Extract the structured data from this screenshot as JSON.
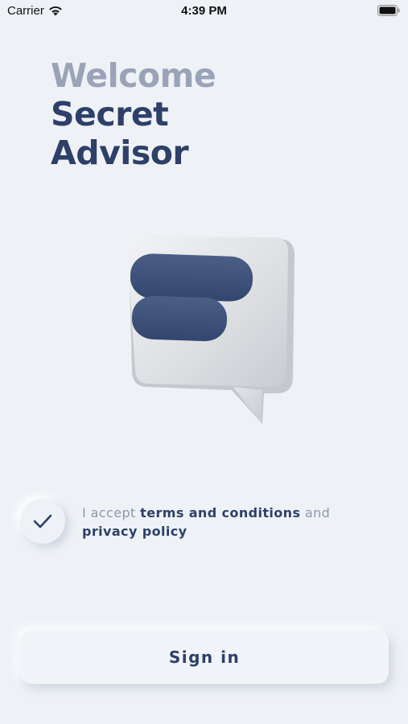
{
  "status_bar": {
    "carrier": "Carrier",
    "time": "4:39 PM"
  },
  "heading": {
    "welcome": "Welcome",
    "line1": "Secret",
    "line2": "Advisor"
  },
  "terms": {
    "checked": true,
    "prefix": "I accept ",
    "terms_link": "terms and conditions",
    "connector": " and",
    "privacy_link": "privacy policy"
  },
  "sign_in": {
    "label": "Sign in"
  },
  "colors": {
    "background": "#eef2f6",
    "primary": "#2e4069",
    "muted": "#9aa3b8"
  }
}
